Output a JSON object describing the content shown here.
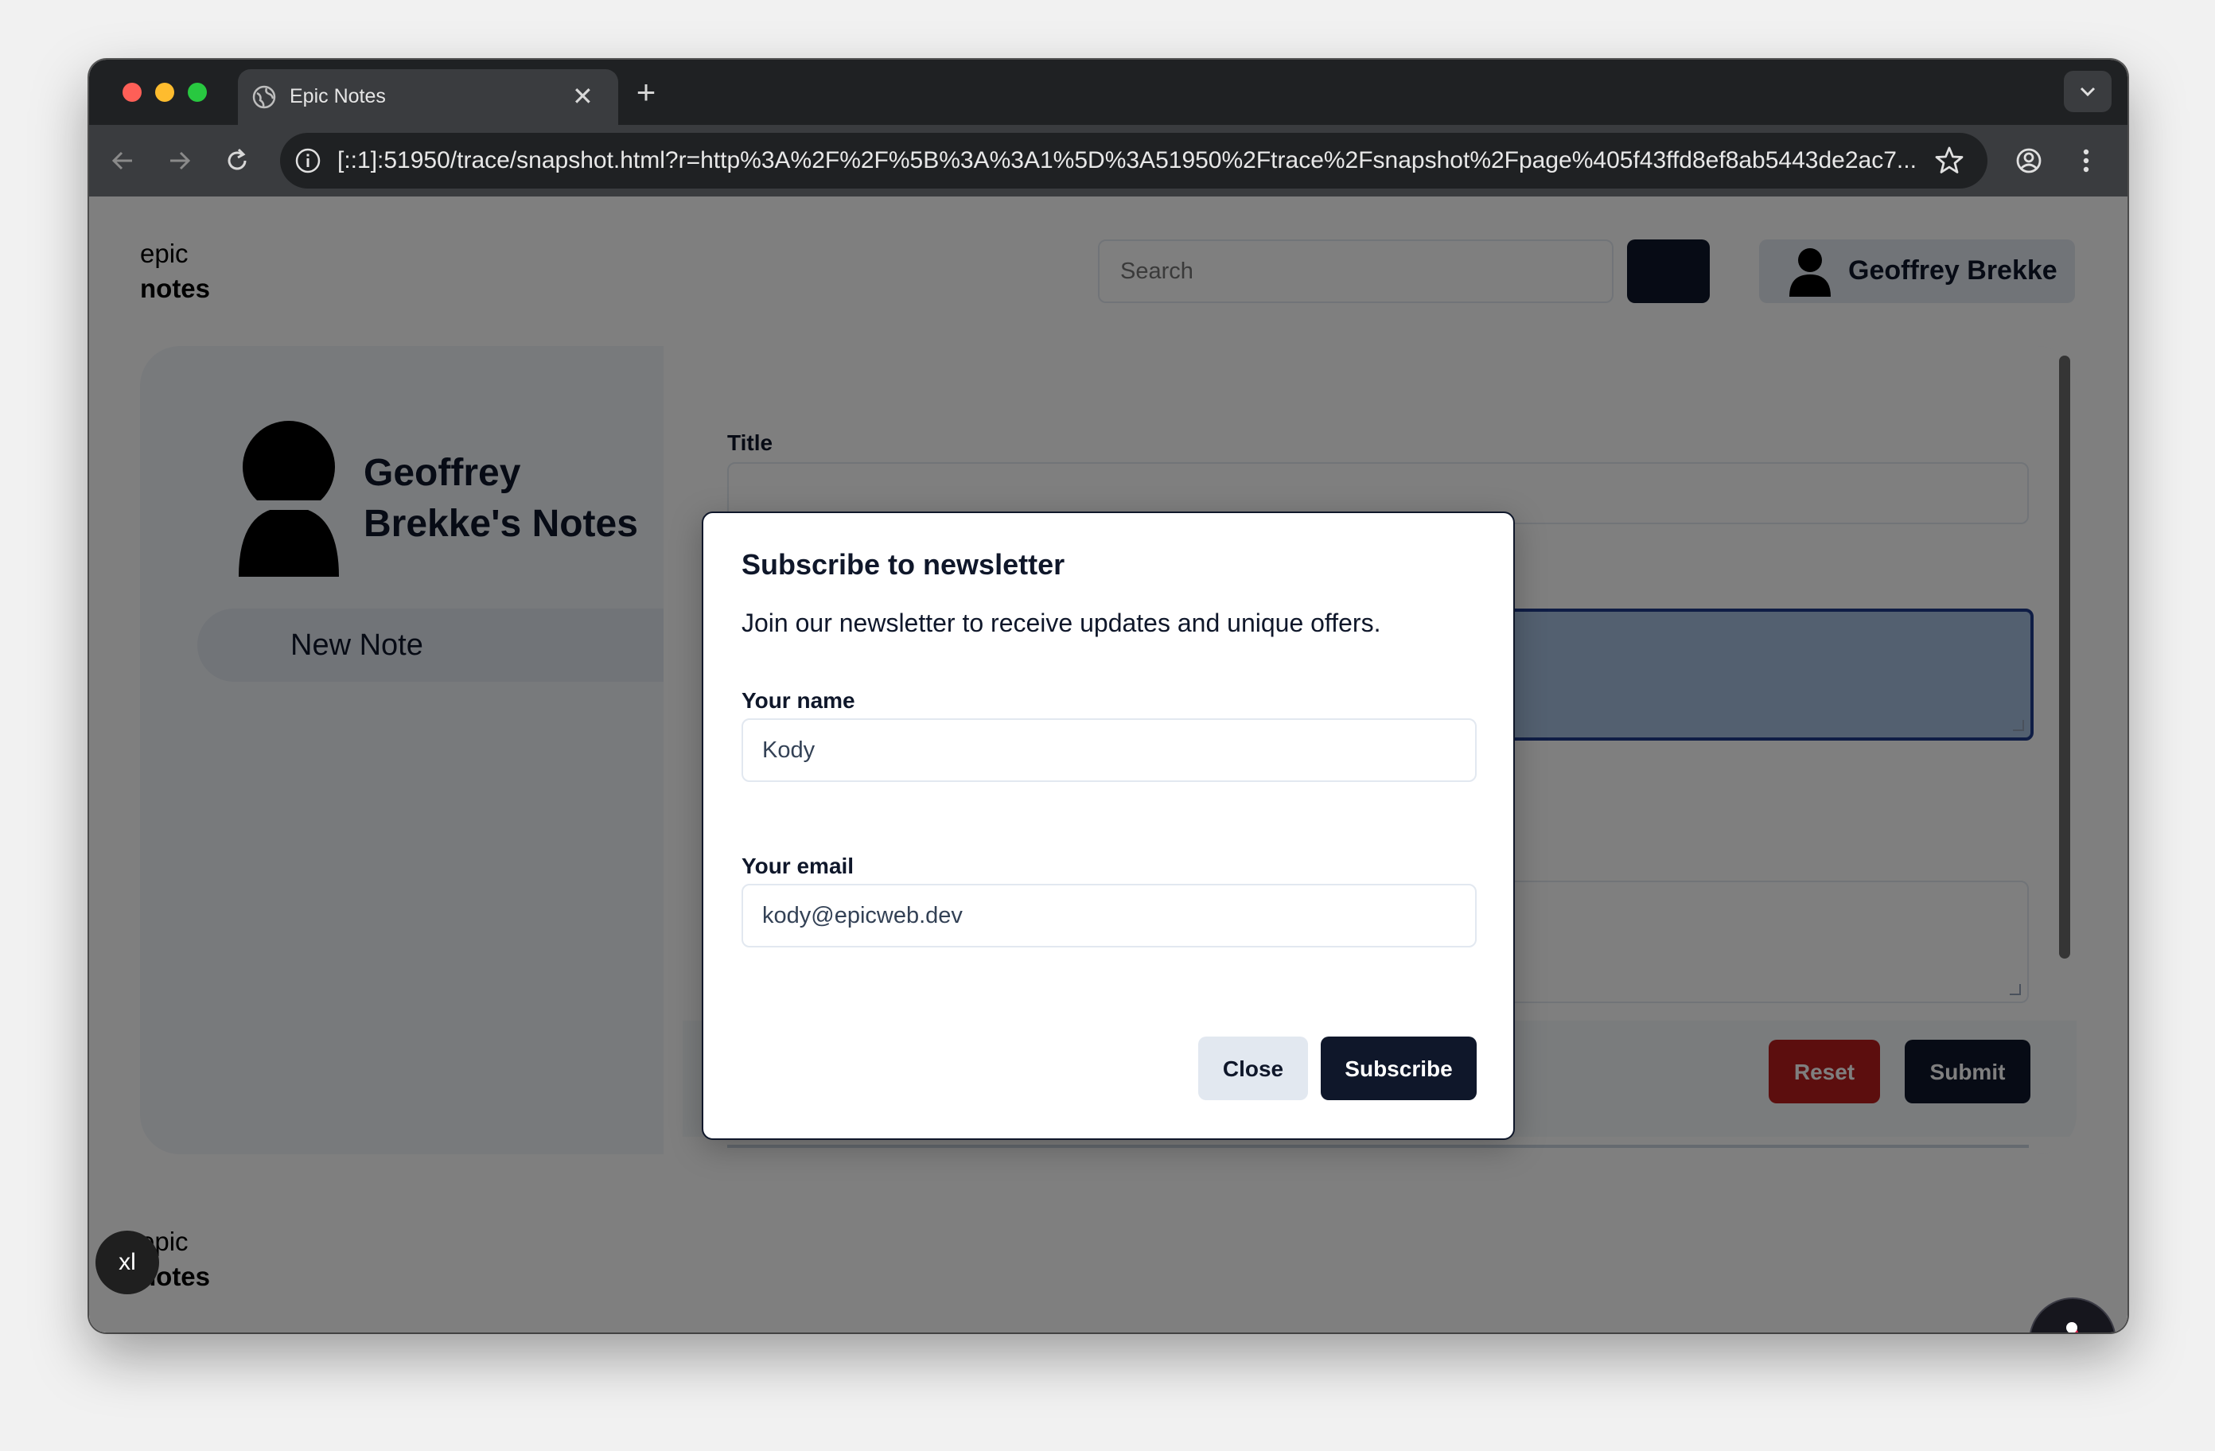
{
  "browser": {
    "tab_title": "Epic Notes",
    "tab_close": "✕",
    "new_tab": "+",
    "url": "[::1]:51950/trace/snapshot.html?r=http%3A%2F%2F%5B%3A%3A1%5D%3A51950%2Ftrace%2Fsnapshot%2Fpage%405f43ffd8ef8ab5443de2ac7..."
  },
  "header": {
    "logo_top": "epic",
    "logo_bottom": "notes",
    "search_placeholder": "Search",
    "user_name": "Geoffrey Brekke"
  },
  "sidebar": {
    "owner_title": "Geoffrey Brekke's Notes",
    "new_note": "New Note"
  },
  "editor": {
    "title_label": "Title",
    "reset_label": "Reset",
    "submit_label": "Submit"
  },
  "footer": {
    "logo_top": "epic",
    "logo_bottom": "notes",
    "size_badge": "xl"
  },
  "modal": {
    "title": "Subscribe to newsletter",
    "description": "Join our newsletter to receive updates and unique offers.",
    "name_label": "Your name",
    "name_value": "Kody",
    "email_label": "Your email",
    "email_value": "kody@epicweb.dev",
    "close_label": "Close",
    "subscribe_label": "Subscribe"
  },
  "colors": {
    "primary": "#0f172a",
    "danger": "#b91c1c",
    "muted": "#e2e8f0"
  }
}
